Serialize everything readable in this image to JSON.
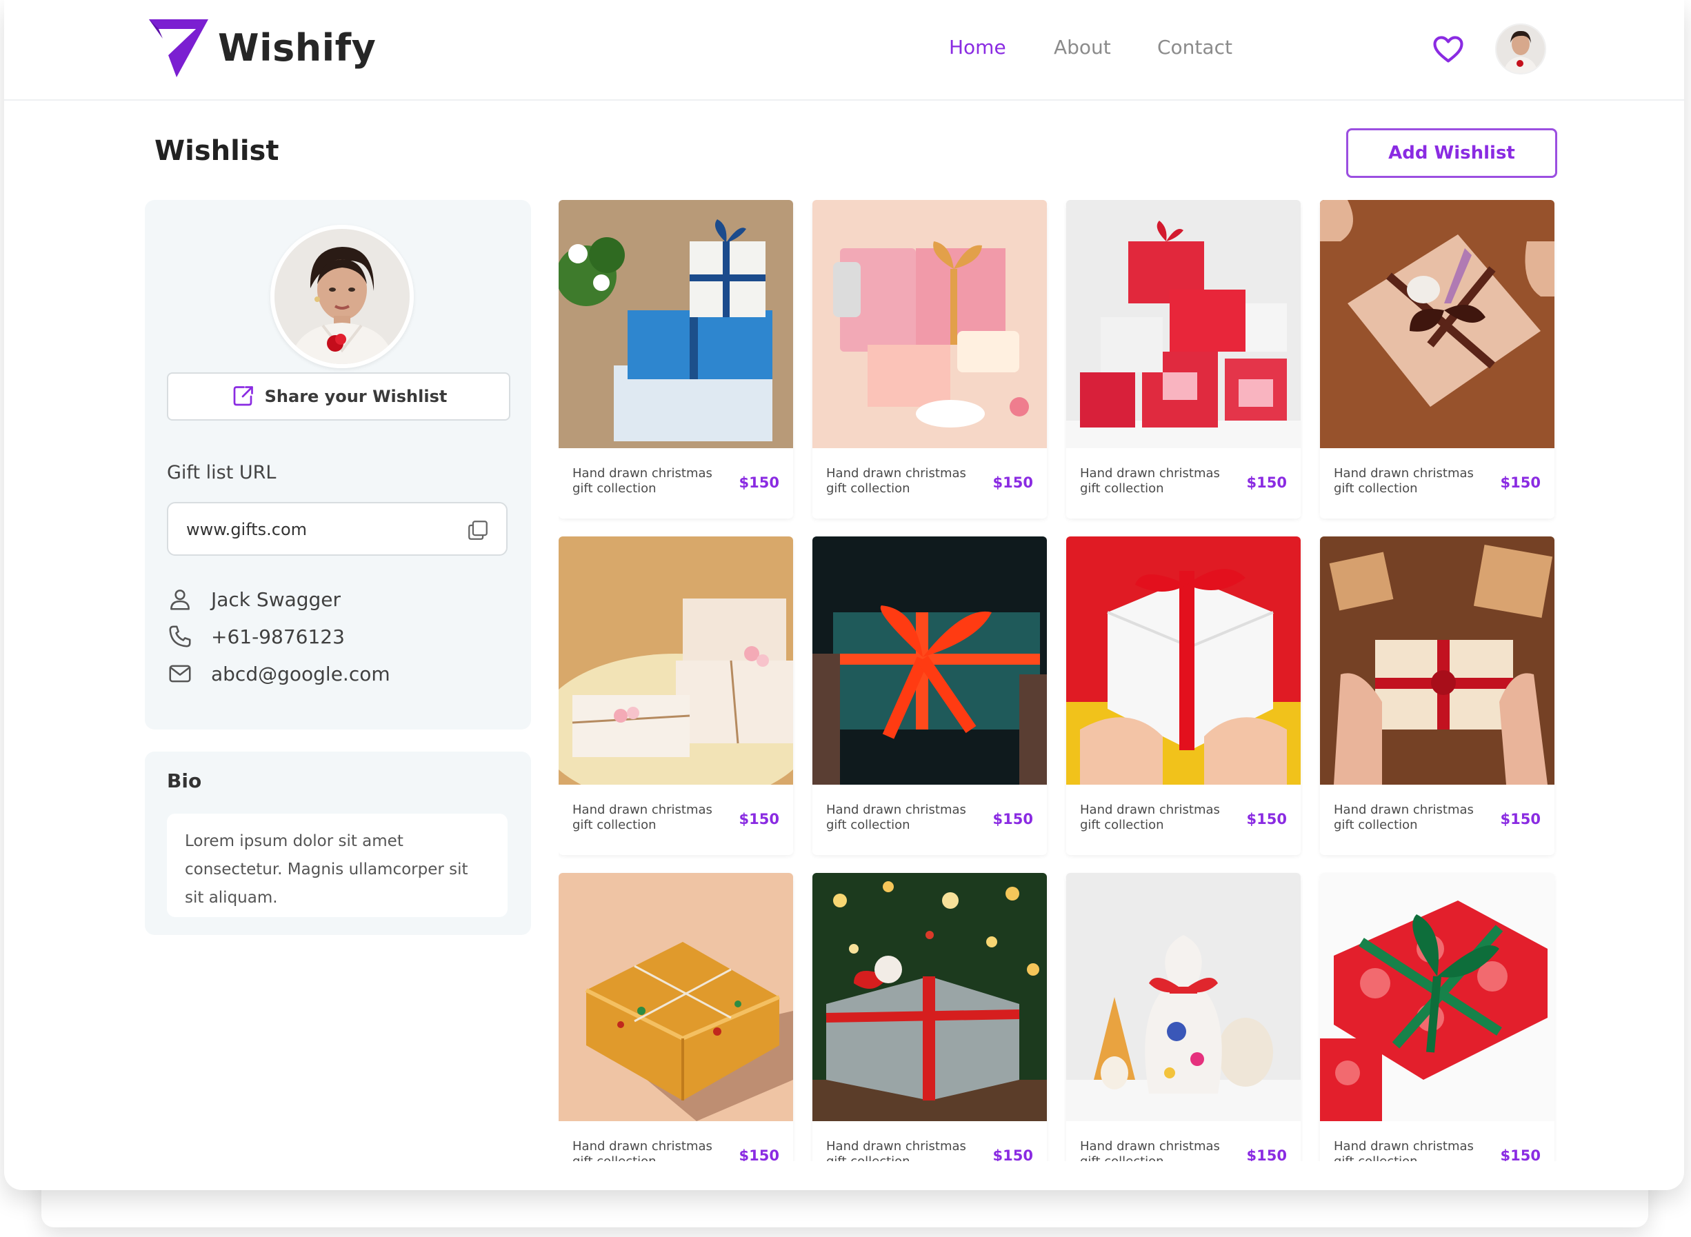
{
  "app": {
    "brand": "Wishify"
  },
  "nav": {
    "home": "Home",
    "about": "About",
    "contact": "Contact"
  },
  "page": {
    "title": "Wishlist",
    "add_button": "Add Wishlist"
  },
  "profile": {
    "share_label": "Share your Wishlist",
    "gift_url_label": "Gift list URL",
    "gift_url": "www.gifts.com",
    "name": "Jack Swagger",
    "phone": "+61-9876123",
    "email": "abcd@google.com"
  },
  "bio": {
    "title": "Bio",
    "text": "Lorem ipsum dolor sit amet consectetur. Magnis ullamcorper sit sit aliquam."
  },
  "products": [
    {
      "title": "Hand drawn christmas gift collection",
      "price": "$150"
    },
    {
      "title": "Hand drawn christmas gift collection",
      "price": "$150"
    },
    {
      "title": "Hand drawn christmas gift collection",
      "price": "$150"
    },
    {
      "title": "Hand drawn christmas gift collection",
      "price": "$150"
    },
    {
      "title": "Hand drawn christmas gift collection",
      "price": "$150"
    },
    {
      "title": "Hand drawn christmas gift collection",
      "price": "$150"
    },
    {
      "title": "Hand drawn christmas gift collection",
      "price": "$150"
    },
    {
      "title": "Hand drawn christmas gift collection",
      "price": "$150"
    },
    {
      "title": "Hand drawn christmas gift collection",
      "price": "$150"
    },
    {
      "title": "Hand drawn christmas gift collection",
      "price": "$150"
    },
    {
      "title": "Hand drawn christmas gift collection",
      "price": "$150"
    },
    {
      "title": "Hand drawn christmas gift collection",
      "price": "$150"
    }
  ],
  "colors": {
    "accent": "#8a2be2",
    "panel": "#f3f7f9"
  },
  "icons": {
    "logo": "wishify-logo-icon",
    "favorites": "heart-icon",
    "share": "share-icon",
    "copy": "copy-icon",
    "user": "user-icon",
    "phone": "phone-icon",
    "email": "mail-icon"
  }
}
